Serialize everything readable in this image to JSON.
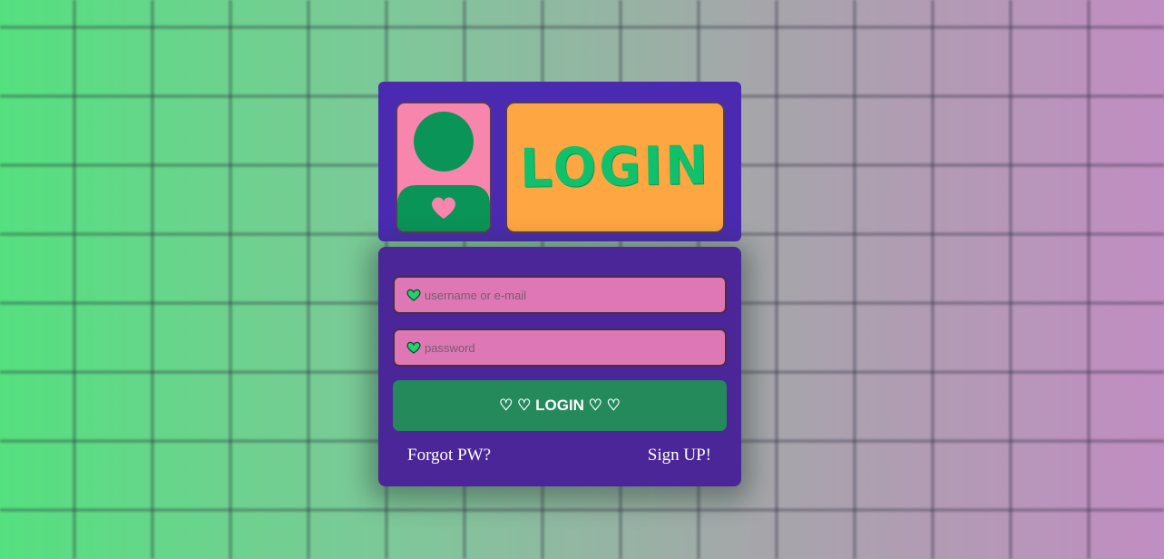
{
  "header": {
    "logo_text": "LOGIN",
    "avatar_icon": "user-heart-avatar"
  },
  "form": {
    "username": {
      "placeholder": "username or e-mail",
      "value": "",
      "icon": "green-heart-icon"
    },
    "password": {
      "placeholder": "password",
      "value": "",
      "icon": "green-heart-icon"
    },
    "submit_label": "♡ ♡ LOGIN ♡ ♡",
    "forgot_label": "Forgot PW?",
    "signup_label": "Sign UP!"
  },
  "colors": {
    "background_left": "#55e07f",
    "background_right": "#c18dc2",
    "card": "#4b2698",
    "avatar_bg": "#f886ac",
    "logo_bg": "#fea742",
    "logo_text": "#10c06a",
    "input_bg": "#de78b4",
    "button": "#248a5c"
  }
}
